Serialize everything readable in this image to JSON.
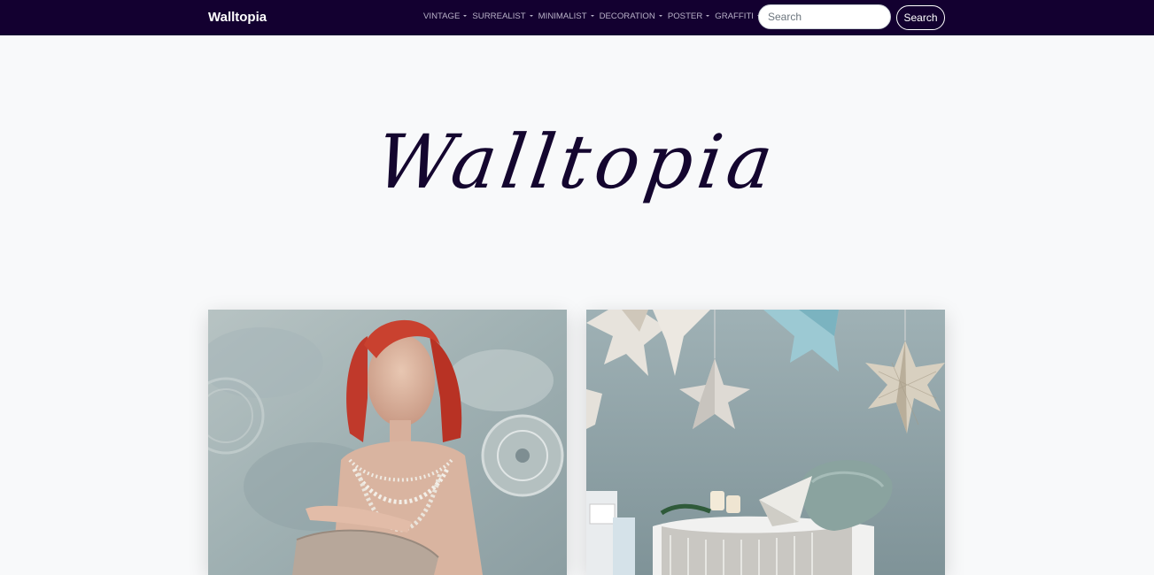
{
  "navbar": {
    "brand": "Walltopia",
    "menu": [
      {
        "label": "VINTAGE"
      },
      {
        "label": "SURREALIST"
      },
      {
        "label": "MINIMALIST"
      },
      {
        "label": "DECORATION"
      },
      {
        "label": "POSTER"
      },
      {
        "label": "GRAFFITI"
      }
    ],
    "search": {
      "placeholder": "Search",
      "value": "",
      "button_label": "Search"
    }
  },
  "hero": {
    "title": "Walltopia"
  },
  "colors": {
    "navbar_bg": "#130030",
    "page_bg": "#f8f9fa",
    "title_color": "#14062f"
  },
  "gallery": [
    {
      "subject": "red-haired woman with pearl necklaces photo"
    },
    {
      "subject": "paper star decorations over bed photo"
    }
  ]
}
